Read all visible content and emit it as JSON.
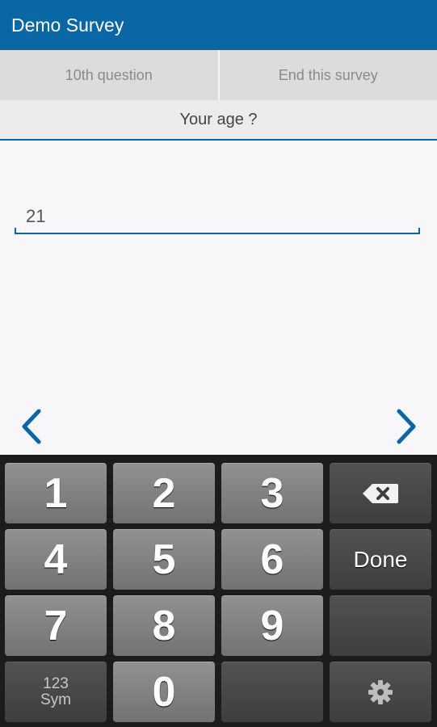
{
  "app": {
    "title": "Demo Survey"
  },
  "top_buttons": {
    "tenth_question": "10th question",
    "end_survey": "End this survey"
  },
  "question": {
    "text": "Your age ?"
  },
  "answer": {
    "value": "21"
  },
  "navigation": {
    "prev_icon": "chevron-left-icon",
    "next_icon": "chevron-right-icon",
    "color": "#0a67a6"
  },
  "keyboard": {
    "keys": [
      "1",
      "2",
      "3",
      "4",
      "5",
      "6",
      "7",
      "8",
      "9",
      "0"
    ],
    "done_label": "Done",
    "sym_label_top": "123",
    "sym_label_bottom": "Sym",
    "backspace_icon": "backspace-icon",
    "settings_icon": "gear-icon"
  },
  "colors": {
    "accent": "#0a67a6",
    "keyboard_bg": "#1b1c1e"
  }
}
